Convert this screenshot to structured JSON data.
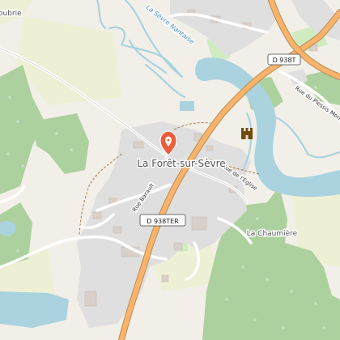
{
  "map": {
    "place_labels": {
      "town": "La Forêt-sur-Sèvre",
      "hamlet": "La Chaumière",
      "edge_top_left": "oubrie"
    },
    "road_labels": {
      "river": "La Sèvre Nantaise",
      "rue_eglise": "Rue de l'Église",
      "rue_barault": "Rue Barault",
      "rue_plessis": "Rue du Plessis Mornay"
    },
    "shields": {
      "d938t": "D 938T",
      "d938ter": "D 938TER"
    },
    "marker": {
      "color": "#ec5d3b",
      "icon": "location-pin-icon"
    },
    "landmark_icon": "castle-icon",
    "colors": {
      "background": "#f2efe9",
      "forest": "#add19e",
      "meadow": "#e6eedb",
      "field": "#eef0d5",
      "water": "#aad3df",
      "residential": "#e0dfdf",
      "trunk_road": "#f9b36b"
    }
  }
}
